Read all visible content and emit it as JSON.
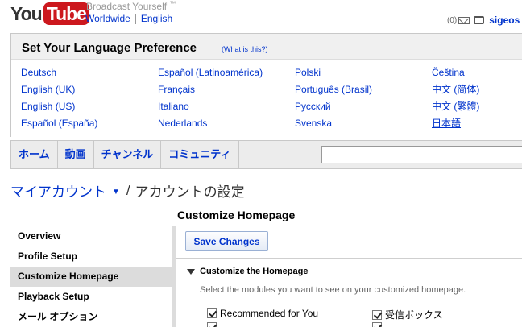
{
  "header": {
    "logo_you": "You",
    "logo_tube": "Tube",
    "tagline": "Broadcast Yourself",
    "tagline_tm": "™",
    "region_worldwide": "Worldwide",
    "region_language": "English",
    "inbox_count": "(0)",
    "username": "sigeos"
  },
  "language": {
    "title": "Set Your Language Preference",
    "help_link": "(What is this?)",
    "columns": [
      [
        "Deutsch",
        "English (UK)",
        "English (US)",
        "Español (España)"
      ],
      [
        "Español (Latinoamérica)",
        "Français",
        "Italiano",
        "Nederlands"
      ],
      [
        "Polski",
        "Português (Brasil)",
        "Русский",
        "Svenska"
      ],
      [
        "Čeština",
        "中文 (简体)",
        "中文 (繁體)",
        "日本語"
      ]
    ]
  },
  "nav": {
    "tabs": [
      "ホーム",
      "動画",
      "チャンネル",
      "コミュニティ"
    ],
    "search_value": ""
  },
  "breadcrumb": {
    "account": "マイアカウント",
    "arrow": "▼",
    "slash": "/",
    "current": "アカウントの設定"
  },
  "sidemenu": {
    "items": [
      "Overview",
      "Profile Setup",
      "Customize Homepage",
      "Playback Setup",
      "メール オプション"
    ]
  },
  "main": {
    "title": "Customize Homepage",
    "save_label": "Save Changes",
    "section_title": "Customize the Homepage",
    "section_desc": "Select the modules you want to see on your customized homepage.",
    "options": [
      "Recommended for You",
      "受信ボックス"
    ]
  },
  "colors": {
    "link": "#0033cc",
    "logo_red": "#cc181e",
    "active_menu": "#dcdcdc"
  }
}
